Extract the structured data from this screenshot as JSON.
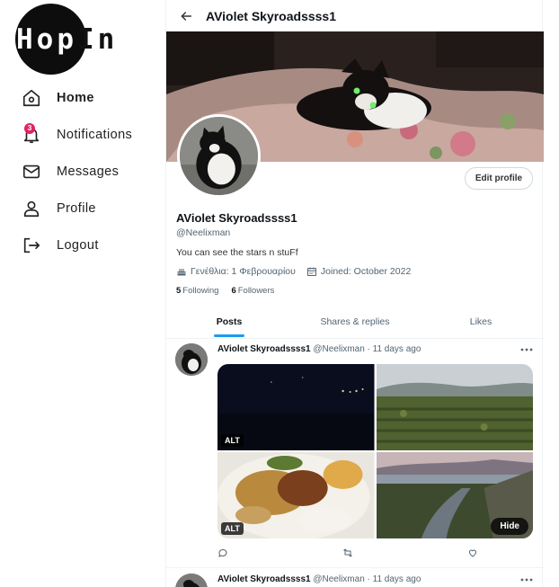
{
  "brand": {
    "logo_prefix": "Hop",
    "logo_suffix": "In"
  },
  "sidebar": {
    "items": [
      {
        "label": "Home",
        "icon": "home-icon",
        "active": true
      },
      {
        "label": "Notifications",
        "icon": "bell-icon",
        "badge": "3"
      },
      {
        "label": "Messages",
        "icon": "envelope-icon"
      },
      {
        "label": "Profile",
        "icon": "user-icon"
      },
      {
        "label": "Logout",
        "icon": "logout-icon"
      }
    ]
  },
  "header": {
    "title": "AViolet Skyroadssss1",
    "back_icon": "arrow-left-icon"
  },
  "profile": {
    "display_name": "AViolet Skyroadssss1",
    "handle": "@Neelixman",
    "bio": "You can see the stars n stuFf",
    "birthday": "Γενέθλια: 1 Φεβρουαρίου",
    "joined": "Joined: October 2022",
    "following_count": "5",
    "following_label": "Following",
    "followers_count": "6",
    "followers_label": "Followers",
    "edit_button": "Edit profile"
  },
  "tabs": [
    {
      "label": "Posts",
      "active": true
    },
    {
      "label": "Shares & replies"
    },
    {
      "label": "Likes"
    }
  ],
  "posts": [
    {
      "author": "AViolet Skyroadssss1",
      "handle_time": "@Neelixman · 11 days ago",
      "media": [
        {
          "alt": "ALT",
          "scene": "night lights"
        },
        {
          "scene": "orchard landscape"
        },
        {
          "alt": "ALT",
          "scene": "food plate"
        },
        {
          "scene": "river valley",
          "hide_button": "Hide"
        }
      ]
    },
    {
      "author": "AViolet Skyroadssss1",
      "handle_time": "@Neelixman · 11 days ago"
    }
  ],
  "colors": {
    "accent": "#1d9bf0",
    "badge": "#e0245e",
    "logo": "#0d0d0d"
  }
}
